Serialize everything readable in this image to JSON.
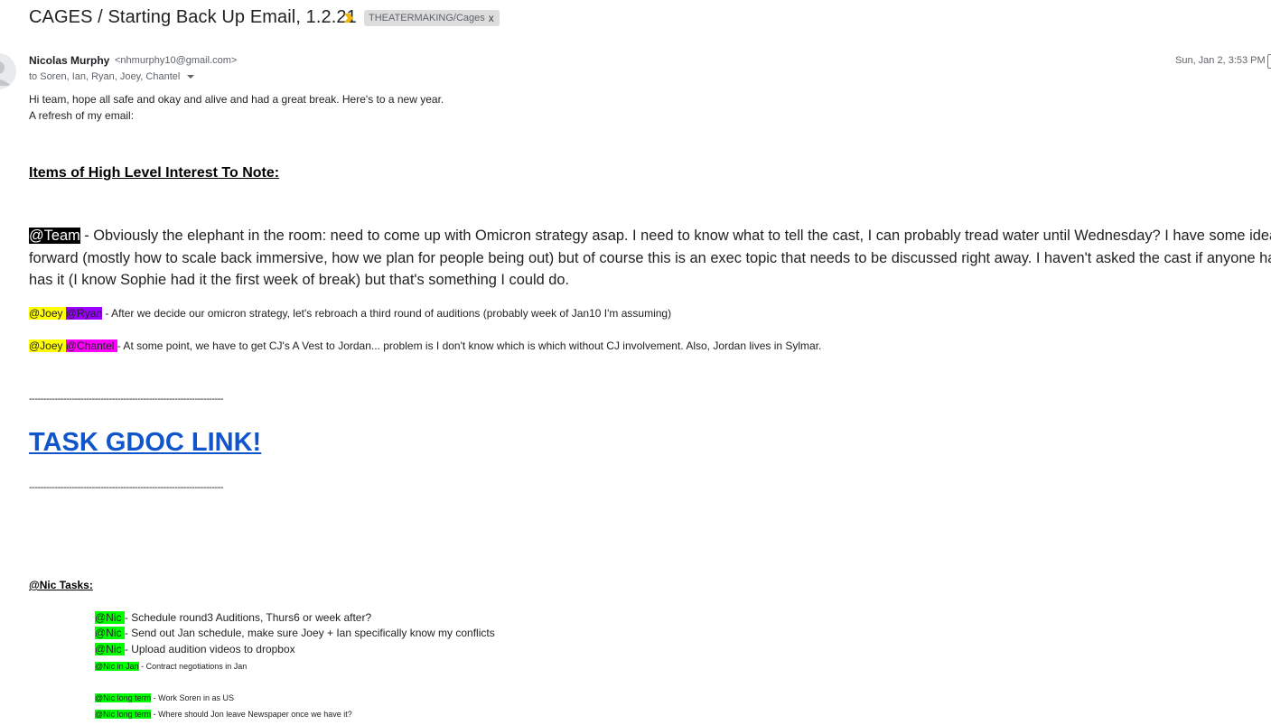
{
  "email": {
    "subject": "CAGES / Starting Back Up Email, 1.2.21",
    "importance_icon": "importance-marker-icon",
    "label": "THEATERMAKING/Cages",
    "label_remove": "x",
    "sender_name": "Nicolas Murphy",
    "sender_email": "<nhmurphy10@gmail.com>",
    "to_line": "to Soren, Ian, Ryan, Joey, Chantel",
    "date": "Sun, Jan 2, 3:53 PM ("
  },
  "body": {
    "greeting": "Hi team, hope all safe and okay and alive and had a great break. Here's to a new year.",
    "refresh": "A refresh of my email:",
    "heading": "Items of High Level Interest To Note:",
    "team_mention": "@Team",
    "team_line1": " - Obviously the elephant in the room: need to come up with Omicron strategy asap. I need to know what to tell the cast, I can probably tread water until Wednesday? I have some idea",
    "team_line2": "forward (mostly how to scale back immersive, how we plan for people being out) but of course this is an exec topic that needs to be discussed right away. I haven't asked the cast if anyone ha",
    "team_line3": "has it (I know Sophie had it the first week of break) but that's something I could do.",
    "auditions_joey": "@Joey ",
    "auditions_ryan": "@Ryan",
    "auditions_text": " - After we decide our omicron strategy, let's rebroach a third round of auditions (probably week of Jan10 I'm assuming)",
    "vest_joey": "@Joey ",
    "vest_chantel": "@Chantel ",
    "vest_text": "- At some point, we have to get CJ's A Vest to Jordan... problem is I don't know which is which without CJ involvement. Also, Jordan lives in Sylmar.",
    "divider": "--------------------------------------------------------------------",
    "gdoc_link": "TASK GDOC LINK!",
    "nic_tasks_title": "@Nic Tasks:",
    "tasks": [
      {
        "mention": "@Nic ",
        "text": "- Schedule round3 Auditions, Thurs6 or week after?"
      },
      {
        "mention": "@Nic ",
        "text": "- Send out Jan schedule, make sure Joey + Ian specifically know my conflicts"
      },
      {
        "mention": "@Nic ",
        "text": "- Upload audition videos to dropbox"
      },
      {
        "mention": "@Nic in Jan",
        "text": " - Contract negotiations in Jan"
      },
      {
        "mention": "@Nic long term",
        "text": " - Work Soren in as US"
      },
      {
        "mention": "@Nic long term",
        "text": " - Where should Jon leave Newspaper once we have it?"
      }
    ]
  },
  "colors": {
    "link": "#1155cc",
    "highlight_yellow": "#ffff00",
    "highlight_purple": "#9900ff",
    "highlight_magenta": "#ff00ff",
    "highlight_green": "#00ff00",
    "highlight_black": "#000000"
  }
}
